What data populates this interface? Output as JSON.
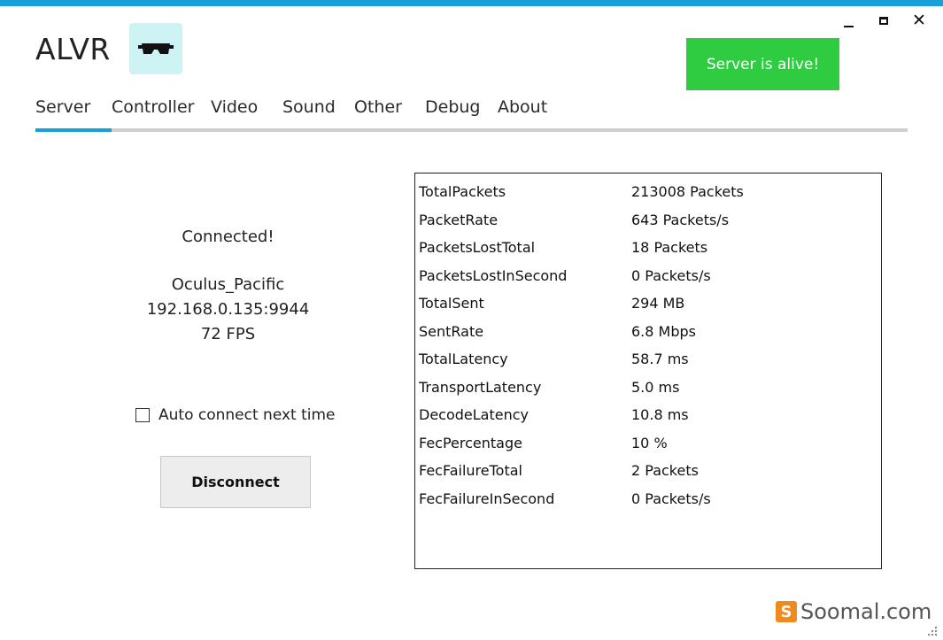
{
  "window": {
    "title": "ALVR",
    "controls": {
      "minimize": "minimize-icon",
      "maximize": "maximize-icon",
      "close": "close-icon"
    }
  },
  "logo": {
    "icon": "vr-headset-icon",
    "bg_color": "#cdf3f5"
  },
  "status": {
    "text": "Server is alive!",
    "color": "#2fcc42"
  },
  "tabs": [
    {
      "label": "Server",
      "active": true
    },
    {
      "label": "Controller",
      "active": false
    },
    {
      "label": "Video",
      "active": false
    },
    {
      "label": "Sound",
      "active": false
    },
    {
      "label": "Other",
      "active": false
    },
    {
      "label": "Debug",
      "active": false
    },
    {
      "label": "About",
      "active": false
    }
  ],
  "accent_color": "#1aa0d8",
  "connection": {
    "status": "Connected!",
    "device_name": "Oculus_Pacific",
    "address": "192.168.0.135:9944",
    "fps": "72 FPS",
    "auto_connect_label": "Auto connect next time",
    "auto_connect_checked": false,
    "disconnect_label": "Disconnect"
  },
  "stats": [
    {
      "key": "TotalPackets",
      "value": "213008 Packets"
    },
    {
      "key": "PacketRate",
      "value": "643 Packets/s"
    },
    {
      "key": "PacketsLostTotal",
      "value": "18 Packets"
    },
    {
      "key": "PacketsLostInSecond",
      "value": "0 Packets/s"
    },
    {
      "key": "TotalSent",
      "value": "294 MB"
    },
    {
      "key": "SentRate",
      "value": "6.8 Mbps"
    },
    {
      "key": "TotalLatency",
      "value": "58.7 ms"
    },
    {
      "key": "TransportLatency",
      "value": "5.0 ms"
    },
    {
      "key": "DecodeLatency",
      "value": "10.8 ms"
    },
    {
      "key": "FecPercentage",
      "value": "10 %"
    },
    {
      "key": "FecFailureTotal",
      "value": "2 Packets"
    },
    {
      "key": "FecFailureInSecond",
      "value": "0 Packets/s"
    }
  ],
  "watermark": {
    "text": "Soomal.com",
    "logo_letter": "S"
  }
}
